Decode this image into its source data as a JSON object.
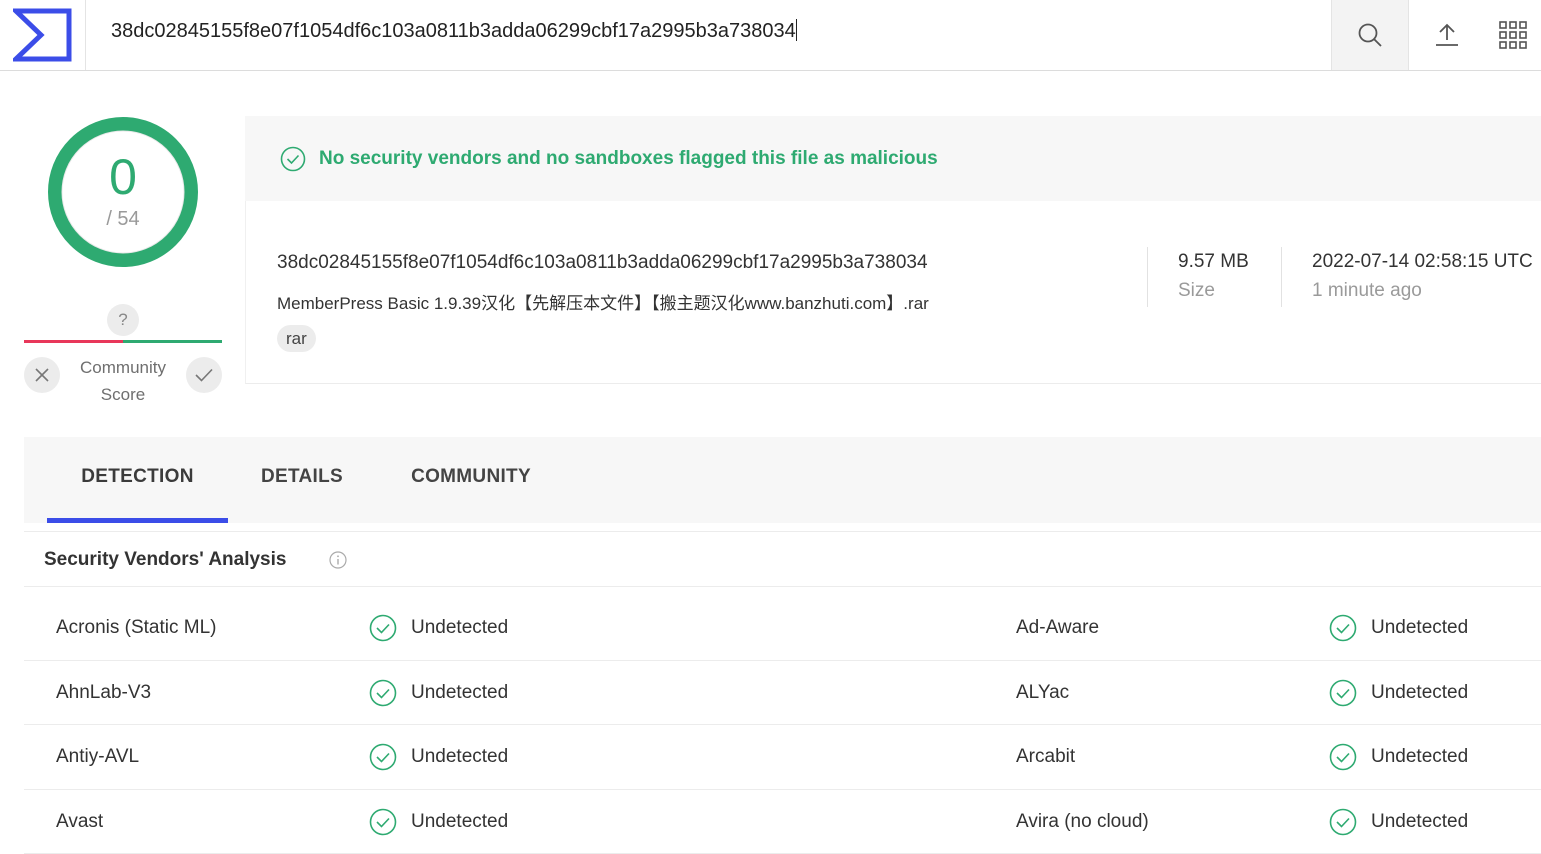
{
  "search": {
    "value": "38dc02845155f8e07f1054df6c103a0811b3adda06299cbf17a2995b3a738034"
  },
  "score": {
    "detections": "0",
    "total": "/ 54"
  },
  "community": {
    "question": "?",
    "label_line1": "Community",
    "label_line2": "Score"
  },
  "verdict": {
    "text": "No security vendors and no sandboxes flagged this file as malicious"
  },
  "file": {
    "hash": "38dc02845155f8e07f1054df6c103a0811b3adda06299cbf17a2995b3a738034",
    "name": "MemberPress Basic 1.9.39汉化【先解压本文件】【搬主题汉化www.banzhuti.com】.rar",
    "tag": "rar",
    "size_value": "9.57 MB",
    "size_label": "Size",
    "date_value": "2022-07-14 02:58:15 UTC",
    "date_label": "1 minute ago"
  },
  "tabs": {
    "detection": "DETECTION",
    "details": "DETAILS",
    "community": "COMMUNITY"
  },
  "analysis": {
    "title": "Security Vendors' Analysis",
    "rows": [
      {
        "left_vendor": "Acronis (Static ML)",
        "left_result": "Undetected",
        "right_vendor": "Ad-Aware",
        "right_result": "Undetected"
      },
      {
        "left_vendor": "AhnLab-V3",
        "left_result": "Undetected",
        "right_vendor": "ALYac",
        "right_result": "Undetected"
      },
      {
        "left_vendor": "Antiy-AVL",
        "left_result": "Undetected",
        "right_vendor": "Arcabit",
        "right_result": "Undetected"
      },
      {
        "left_vendor": "Avast",
        "left_result": "Undetected",
        "right_vendor": "Avira (no cloud)",
        "right_result": "Undetected"
      }
    ]
  },
  "colors": {
    "accent": "#3b4de8",
    "clean": "#2eaa71",
    "malicious": "#e8375a"
  },
  "icons": {
    "logo": "sigma-logo-icon",
    "search": "search-icon",
    "upload": "upload-icon",
    "apps": "grid-icon",
    "check": "check-circle-icon",
    "info": "info-icon"
  }
}
